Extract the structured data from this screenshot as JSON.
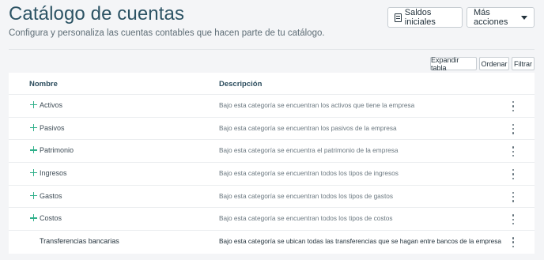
{
  "header": {
    "title": "Catálogo de cuentas",
    "subtitle": "Configura y personaliza las cuentas contables que hacen parte de tu catálogo.",
    "saldos_label": "Saldos iniciales",
    "mas_acciones_label": "Más acciones"
  },
  "toolbar": {
    "expandir_label": "Expandir tabla",
    "ordenar_label": "Ordenar",
    "filtrar_label": "Filtrar"
  },
  "table": {
    "columns": [
      "Nombre",
      "Descripción"
    ],
    "rows": [
      {
        "name": "Activos",
        "description": "Bajo esta categoría se encuentran los activos que tiene la empresa",
        "expandable": true
      },
      {
        "name": "Pasivos",
        "description": "Bajo esta categoría se encuentran los pasivos de la empresa",
        "expandable": true
      },
      {
        "name": "Patrimonio",
        "description": "Bajo esta categoría se encuentra el patrimonio de la empresa",
        "expandable": true
      },
      {
        "name": "Ingresos",
        "description": "Bajo esta categoría se encuentran todos los tipos de ingresos",
        "expandable": true
      },
      {
        "name": "Gastos",
        "description": "Bajo esta categoría se encuentran todos los tipos de gastos",
        "expandable": true
      },
      {
        "name": "Costos",
        "description": "Bajo esta categoría se encuentran todos los tipos de costos",
        "expandable": true
      },
      {
        "name": "Transferencias bancarias",
        "description": "Bajo esta categoría se ubican todas las transferencias que se hagan entre bancos de la empresa",
        "expandable": false
      }
    ]
  },
  "colors": {
    "accent_plus": "#2fb08a",
    "title": "#2c5364"
  },
  "icons": {
    "expand": "plus-icon",
    "row_menu": "kebab-menu-icon",
    "saldos": "document-icon",
    "dropdown": "caret-down-icon"
  }
}
